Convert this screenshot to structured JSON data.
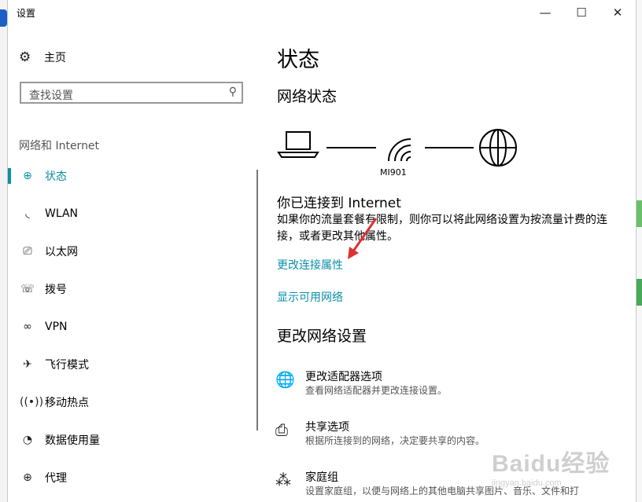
{
  "window": {
    "title": "设置",
    "min_glyph": "—",
    "max_glyph": "☐",
    "close_glyph": "✕"
  },
  "sidebar": {
    "home": {
      "icon": "gear-icon",
      "label": "主页"
    },
    "search_placeholder": "查找设置",
    "section_title": "网络和 Internet",
    "items": [
      {
        "icon": "globe-icon",
        "label": "状态",
        "active": true
      },
      {
        "icon": "wifi-icon",
        "label": "WLAN"
      },
      {
        "icon": "ethernet-icon",
        "label": "以太网"
      },
      {
        "icon": "dialup-icon",
        "label": "拨号"
      },
      {
        "icon": "vpn-icon",
        "label": "VPN"
      },
      {
        "icon": "airplane-icon",
        "label": "飞行模式"
      },
      {
        "icon": "hotspot-icon",
        "label": "移动热点"
      },
      {
        "icon": "data-usage-icon",
        "label": "数据使用量"
      },
      {
        "icon": "proxy-icon",
        "label": "代理"
      }
    ]
  },
  "main": {
    "title": "状态",
    "network_status_title": "网络状态",
    "network_name": "MI901",
    "connected_text": "你已连接到 Internet",
    "description": "如果你的流量套餐有限制，则你可以将此网络设置为按流量计费的连接，或者更改其他属性。",
    "link_change_properties": "更改连接属性",
    "link_show_networks": "显示可用网络",
    "change_settings_title": "更改网络设置",
    "options": [
      {
        "icon": "adapter-icon",
        "title": "更改适配器选项",
        "desc": "查看网络适配器并更改连接设置。"
      },
      {
        "icon": "sharing-icon",
        "title": "共享选项",
        "desc": "根据所连接到的网络，决定要共享的内容。"
      },
      {
        "icon": "homegroup-icon",
        "title": "家庭组",
        "desc": "设置家庭组，以便与网络上的其他电脑共享图片、音乐、文件和打"
      }
    ]
  },
  "colors": {
    "accent": "#0b8fa8",
    "annotation_arrow": "#e03030"
  },
  "watermark": {
    "line1": "Baidu经验",
    "line2": "jingyan.baidu.com"
  }
}
